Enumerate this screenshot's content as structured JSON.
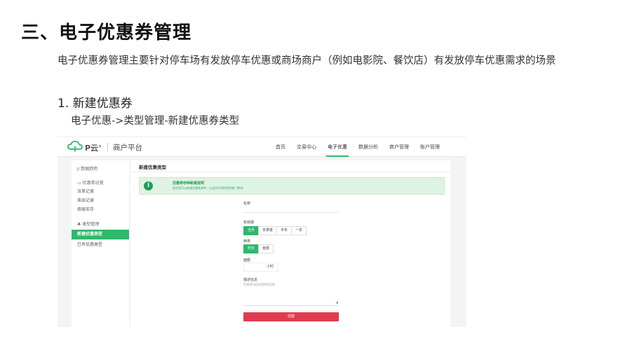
{
  "doc": {
    "title": "三、电子优惠券管理",
    "intro": "电子优惠券管理主要针对停车场有发放停车优惠或商场商户（例如电影院、餐饮店）有发放停车优惠需求的场景",
    "section_heading": "1. 新建优惠券",
    "section_path": "电子优惠->类型管理-新建优惠券类型"
  },
  "app": {
    "logo_text": "P云",
    "platform": "商户平台",
    "brand_color": "#2fb86b",
    "nav": [
      "首页",
      "交易中心",
      "电子优惠",
      "数据分析",
      "商户管理",
      "账户管理"
    ],
    "nav_active": "电子优惠",
    "sidebar": {
      "trend": "数据趋势",
      "coupon_group": "优惠券运营",
      "issue_records": "派发记录",
      "sell_records": "卖出记录",
      "merchant_stock": "商家库存",
      "type_group": "类型管理",
      "new_type": "新建优惠类型",
      "existing_types": "已有优惠类型"
    },
    "main": {
      "title": "新建优惠类型",
      "notice_title": "优惠券存种新建说明",
      "notice_text": "现在您可以新建优惠券券种，以支持不同的宣传推广需求!",
      "name_label": "名称",
      "validity_label": "有效期",
      "validity_options": [
        "当月",
        "本季度",
        "半年",
        "一年"
      ],
      "validity_selected": "当月",
      "type_label": "种类",
      "type_options": [
        "时长",
        "金额"
      ],
      "type_selected": "时长",
      "duration_label": "面额",
      "duration_unit": "小时",
      "desc_label": "描述信息",
      "desc_placeholder": "优惠券派放说明和说明",
      "create_label": "创建"
    }
  }
}
